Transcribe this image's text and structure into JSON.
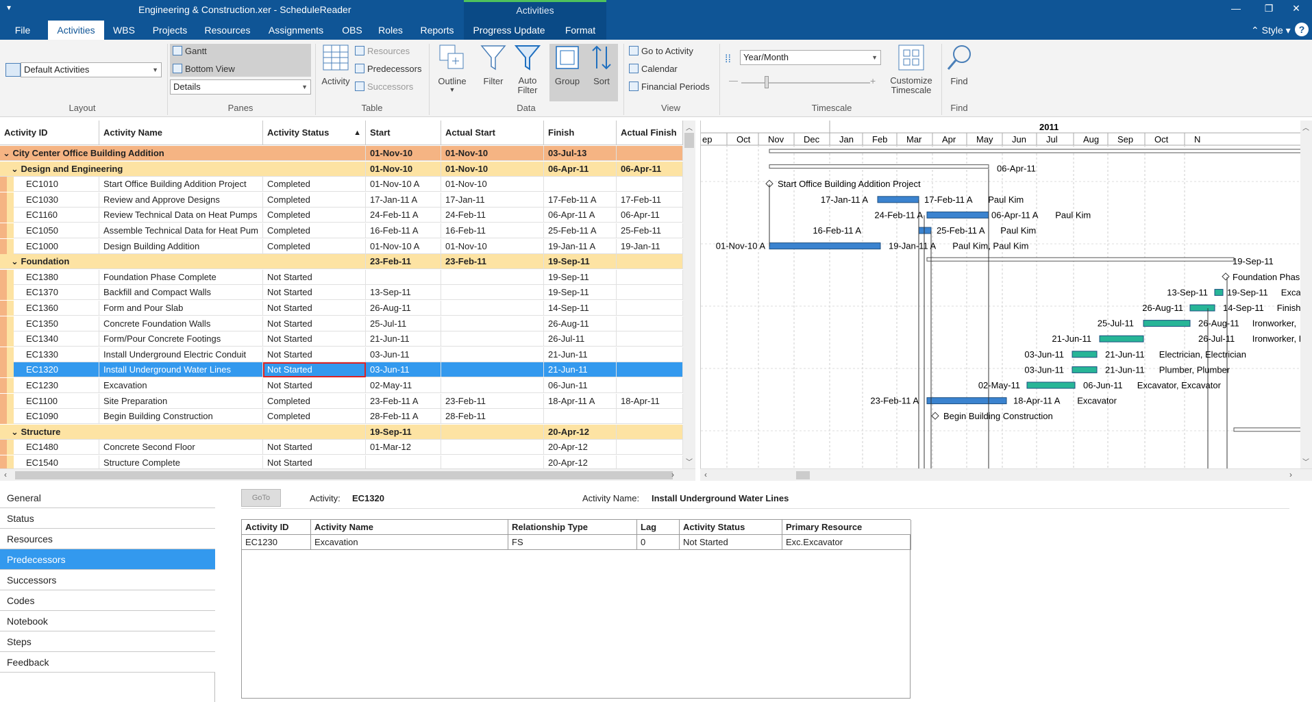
{
  "window": {
    "title": "Engineering & Construction.xer - ScheduleReader",
    "context_tab": "Activities"
  },
  "menu": {
    "tabs": [
      "File",
      "Activities",
      "WBS",
      "Projects",
      "Resources",
      "Assignments",
      "OBS",
      "Roles",
      "Reports",
      "Progress Update",
      "Format"
    ],
    "active": "Activities",
    "style_label": "Style"
  },
  "ribbon": {
    "layout": {
      "value": "Default Activities",
      "label": "Layout"
    },
    "panes": {
      "gantt": "Gantt",
      "bottom_view": "Bottom View",
      "details": "Details",
      "label": "Panes"
    },
    "table": {
      "activity": "Activity",
      "resources": "Resources",
      "predecessors": "Predecessors",
      "successors": "Successors",
      "label": "Table"
    },
    "data": {
      "outline": "Outline",
      "filter": "Filter",
      "auto_filter_1": "Auto",
      "auto_filter_2": "Filter",
      "group": "Group",
      "sort": "Sort",
      "label": "Data"
    },
    "view": {
      "go_to_activity": "Go to Activity",
      "calendar": "Calendar",
      "financial_periods": "Financial Periods",
      "label": "View"
    },
    "timescale": {
      "value": "Year/Month",
      "customize_1": "Customize",
      "customize_2": "Timescale",
      "label": "Timescale"
    },
    "find": {
      "find": "Find",
      "label": "Find"
    }
  },
  "grid": {
    "columns": [
      "Activity ID",
      "Activity Name",
      "Activity Status",
      "Start",
      "Actual Start",
      "Finish",
      "Actual Finish"
    ],
    "rows": [
      {
        "level": 0,
        "type": "group",
        "id": "City Center Office Building Addition",
        "name": "",
        "status": "",
        "start": "01-Nov-10",
        "astart": "01-Nov-10",
        "finish": "03-Jul-13",
        "afinish": ""
      },
      {
        "level": 1,
        "type": "group",
        "id": "Design and Engineering",
        "name": "",
        "status": "",
        "start": "01-Nov-10",
        "astart": "01-Nov-10",
        "finish": "06-Apr-11",
        "afinish": "06-Apr-11"
      },
      {
        "level": 2,
        "type": "act",
        "id": "EC1010",
        "name": "Start Office Building Addition Project",
        "status": "Completed",
        "start": "01-Nov-10 A",
        "astart": "01-Nov-10",
        "finish": "",
        "afinish": ""
      },
      {
        "level": 2,
        "type": "act",
        "id": "EC1030",
        "name": "Review and Approve Designs",
        "status": "Completed",
        "start": "17-Jan-11 A",
        "astart": "17-Jan-11",
        "finish": "17-Feb-11 A",
        "afinish": "17-Feb-11"
      },
      {
        "level": 2,
        "type": "act",
        "id": "EC1160",
        "name": "Review Technical Data on Heat Pumps",
        "status": "Completed",
        "start": "24-Feb-11 A",
        "astart": "24-Feb-11",
        "finish": "06-Apr-11 A",
        "afinish": "06-Apr-11"
      },
      {
        "level": 2,
        "type": "act",
        "id": "EC1050",
        "name": "Assemble Technical Data for Heat Pum",
        "status": "Completed",
        "start": "16-Feb-11 A",
        "astart": "16-Feb-11",
        "finish": "25-Feb-11 A",
        "afinish": "25-Feb-11"
      },
      {
        "level": 2,
        "type": "act",
        "id": "EC1000",
        "name": "Design Building Addition",
        "status": "Completed",
        "start": "01-Nov-10 A",
        "astart": "01-Nov-10",
        "finish": "19-Jan-11 A",
        "afinish": "19-Jan-11"
      },
      {
        "level": 1,
        "type": "group",
        "id": "Foundation",
        "name": "",
        "status": "",
        "start": "23-Feb-11",
        "astart": "23-Feb-11",
        "finish": "19-Sep-11",
        "afinish": ""
      },
      {
        "level": 2,
        "type": "act",
        "id": "EC1380",
        "name": "Foundation Phase Complete",
        "status": "Not Started",
        "start": "",
        "astart": "",
        "finish": "19-Sep-11",
        "afinish": ""
      },
      {
        "level": 2,
        "type": "act",
        "id": "EC1370",
        "name": "Backfill and Compact Walls",
        "status": "Not Started",
        "start": "13-Sep-11",
        "astart": "",
        "finish": "19-Sep-11",
        "afinish": ""
      },
      {
        "level": 2,
        "type": "act",
        "id": "EC1360",
        "name": "Form and Pour Slab",
        "status": "Not Started",
        "start": "26-Aug-11",
        "astart": "",
        "finish": "14-Sep-11",
        "afinish": ""
      },
      {
        "level": 2,
        "type": "act",
        "id": "EC1350",
        "name": "Concrete Foundation Walls",
        "status": "Not Started",
        "start": "25-Jul-11",
        "astart": "",
        "finish": "26-Aug-11",
        "afinish": ""
      },
      {
        "level": 2,
        "type": "act",
        "id": "EC1340",
        "name": "Form/Pour Concrete Footings",
        "status": "Not Started",
        "start": "21-Jun-11",
        "astart": "",
        "finish": "26-Jul-11",
        "afinish": ""
      },
      {
        "level": 2,
        "type": "act",
        "id": "EC1330",
        "name": "Install Underground Electric Conduit",
        "status": "Not Started",
        "start": "03-Jun-11",
        "astart": "",
        "finish": "21-Jun-11",
        "afinish": ""
      },
      {
        "level": 2,
        "type": "act",
        "id": "EC1320",
        "name": "Install Underground Water Lines",
        "status": "Not Started",
        "start": "03-Jun-11",
        "astart": "",
        "finish": "21-Jun-11",
        "afinish": "",
        "selected": true
      },
      {
        "level": 2,
        "type": "act",
        "id": "EC1230",
        "name": "Excavation",
        "status": "Not Started",
        "start": "02-May-11",
        "astart": "",
        "finish": "06-Jun-11",
        "afinish": ""
      },
      {
        "level": 2,
        "type": "act",
        "id": "EC1100",
        "name": "Site Preparation",
        "status": "Completed",
        "start": "23-Feb-11 A",
        "astart": "23-Feb-11",
        "finish": "18-Apr-11 A",
        "afinish": "18-Apr-11"
      },
      {
        "level": 2,
        "type": "act",
        "id": "EC1090",
        "name": "Begin Building Construction",
        "status": "Completed",
        "start": "28-Feb-11 A",
        "astart": "28-Feb-11",
        "finish": "",
        "afinish": ""
      },
      {
        "level": 1,
        "type": "group",
        "id": "Structure",
        "name": "",
        "status": "",
        "start": "19-Sep-11",
        "astart": "",
        "finish": "20-Apr-12",
        "afinish": ""
      },
      {
        "level": 2,
        "type": "act",
        "id": "EC1480",
        "name": "Concrete Second Floor",
        "status": "Not Started",
        "start": "01-Mar-12",
        "astart": "",
        "finish": "20-Apr-12",
        "afinish": ""
      },
      {
        "level": 2,
        "type": "act",
        "id": "EC1540",
        "name": "Structure Complete",
        "status": "Not Started",
        "start": "",
        "astart": "",
        "finish": "20-Apr-12",
        "afinish": ""
      }
    ]
  },
  "gantt": {
    "year": "2011",
    "months": [
      "ep",
      "Oct",
      "Nov",
      "Dec",
      "Jan",
      "Feb",
      "Mar",
      "Apr",
      "May",
      "Jun",
      "Jul",
      "Aug",
      "Sep",
      "Oct",
      "N"
    ],
    "labels": [
      {
        "row": 1,
        "right": "06-Apr-11"
      },
      {
        "row": 2,
        "right": "Start Office Building Addition Project"
      },
      {
        "row": 3,
        "left": "17-Jan-11 A",
        "right": "17-Feb-11 A",
        "res": "Paul Kim"
      },
      {
        "row": 4,
        "left": "24-Feb-11 A",
        "right": "06-Apr-11 A",
        "res": "Paul Kim"
      },
      {
        "row": 5,
        "left": "16-Feb-11 A",
        "right": "25-Feb-11 A",
        "res": "Paul Kim"
      },
      {
        "row": 6,
        "left": "01-Nov-10 A",
        "right": "19-Jan-11 A",
        "res": "Paul Kim, Paul Kim"
      },
      {
        "row": 7,
        "right": "19-Sep-11"
      },
      {
        "row": 8,
        "right": "Foundation Phas"
      },
      {
        "row": 9,
        "left": "13-Sep-11",
        "right": "19-Sep-11",
        "res": "Exca"
      },
      {
        "row": 10,
        "left": "26-Aug-11",
        "right": "14-Sep-11",
        "res": "Finish"
      },
      {
        "row": 11,
        "left": "25-Jul-11",
        "right": "26-Aug-11",
        "res": "Ironworker,"
      },
      {
        "row": 12,
        "left": "21-Jun-11",
        "right": "26-Jul-11",
        "res": "Ironworker, Rough Carp"
      },
      {
        "row": 13,
        "left": "03-Jun-11",
        "right": "21-Jun-11",
        "res": "Electrician, Electrician"
      },
      {
        "row": 14,
        "left": "03-Jun-11",
        "right": "21-Jun-11",
        "res": "Plumber, Plumber"
      },
      {
        "row": 15,
        "left": "02-May-11",
        "right": "06-Jun-11",
        "res": "Excavator, Excavator"
      },
      {
        "row": 16,
        "left": "23-Feb-11 A",
        "right": "18-Apr-11 A",
        "res": "Excavator"
      },
      {
        "row": 17,
        "right": "Begin Building Construction"
      }
    ]
  },
  "bottom": {
    "tabs": [
      "General",
      "Status",
      "Resources",
      "Predecessors",
      "Successors",
      "Codes",
      "Notebook",
      "Steps",
      "Feedback"
    ],
    "active": "Predecessors",
    "goto": "GoTo",
    "activity_label": "Activity:",
    "activity_value": "EC1320",
    "name_label": "Activity Name:",
    "name_value": "Install Underground Water Lines",
    "table": {
      "columns": [
        "Activity ID",
        "Activity Name",
        "Relationship Type",
        "Lag",
        "Activity Status",
        "Primary Resource"
      ],
      "rows": [
        [
          "EC1230",
          "Excavation",
          "FS",
          "0",
          "Not Started",
          "Exc.Excavator"
        ]
      ]
    }
  }
}
